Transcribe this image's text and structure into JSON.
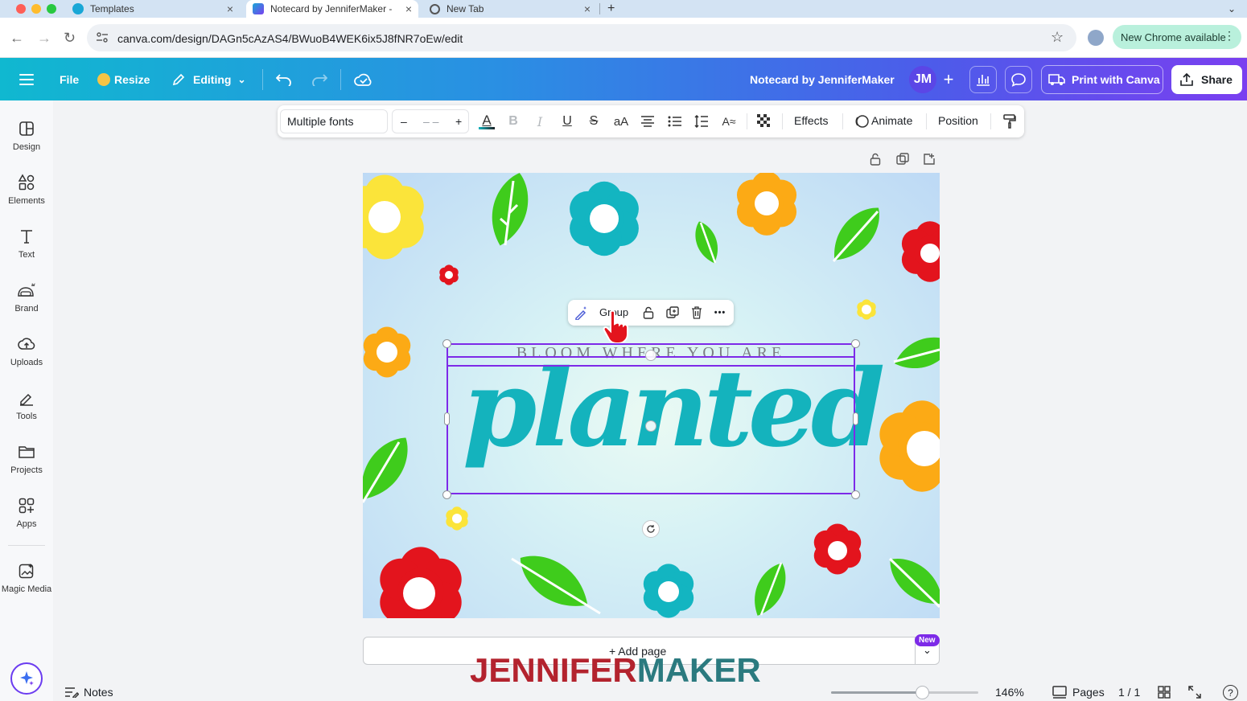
{
  "browser": {
    "tabs": [
      {
        "title": "Templates"
      },
      {
        "title": "Notecard by JenniferMaker -"
      },
      {
        "title": "New Tab"
      }
    ],
    "url": "canva.com/design/DAGn5cAzAS4/BWuoB4WEK6ix5J8fNR7oEw/edit",
    "update_button": "New Chrome available",
    "close_icon": "×",
    "new_tab_icon": "+"
  },
  "header": {
    "file": "File",
    "resize": "Resize",
    "editing": "Editing",
    "doc_title": "Notecard by JenniferMaker",
    "avatar": "JM",
    "print": "Print with Canva",
    "share": "Share",
    "colors": {
      "gradient_start": "#10b8d0",
      "gradient_end": "#7a3ff0"
    }
  },
  "sidebar": {
    "items": [
      {
        "label": "Design",
        "icon": "design-icon"
      },
      {
        "label": "Elements",
        "icon": "elements-icon"
      },
      {
        "label": "Text",
        "icon": "text-icon"
      },
      {
        "label": "Brand",
        "icon": "brand-icon"
      },
      {
        "label": "Uploads",
        "icon": "uploads-icon"
      },
      {
        "label": "Tools",
        "icon": "tools-icon"
      },
      {
        "label": "Projects",
        "icon": "projects-icon"
      },
      {
        "label": "Apps",
        "icon": "apps-icon"
      },
      {
        "label": "Magic Media",
        "icon": "magic-media-icon"
      }
    ]
  },
  "toolbar": {
    "font": "Multiple fonts",
    "size_minus": "–",
    "size_value": "– –",
    "size_plus": "+",
    "case": "aA",
    "effects": "Effects",
    "animate": "Animate",
    "position": "Position"
  },
  "canvas": {
    "tagline": "BLOOM WHERE YOU ARE",
    "script": "planted",
    "float_toolbar": {
      "group": "Group",
      "more": "•••"
    },
    "colors": {
      "script": "#14b3bd",
      "selection": "#7d2ae8"
    }
  },
  "add_page": {
    "label": "+ Add page",
    "badge": "New"
  },
  "watermark": {
    "part1": "JENNIFER",
    "part2": "MAKER"
  },
  "footer": {
    "notes": "Notes",
    "zoom": "146%",
    "zoom_fraction": 0.62,
    "pages": "Pages",
    "page_count": "1 / 1",
    "help": "?"
  }
}
